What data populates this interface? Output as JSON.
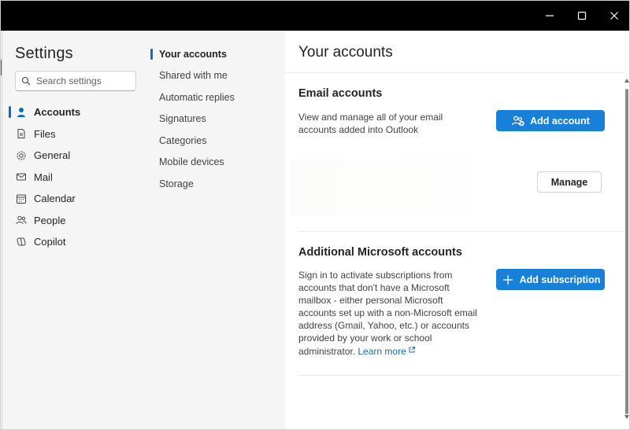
{
  "window": {
    "controls": {
      "minimize_icon": "minimize-icon",
      "maximize_icon": "maximize-icon",
      "close_icon": "close-icon"
    }
  },
  "colors": {
    "accent": "#0f6cbd",
    "primary_button": "#1880d8",
    "sidebar_bg": "#f5f5f5",
    "titlebar_bg": "#000000"
  },
  "sidebar": {
    "title": "Settings",
    "search": {
      "placeholder": "Search settings",
      "value": ""
    },
    "items": [
      {
        "label": "Accounts",
        "icon": "person-icon",
        "active": true
      },
      {
        "label": "Files",
        "icon": "document-icon",
        "active": false
      },
      {
        "label": "General",
        "icon": "gear-icon",
        "active": false
      },
      {
        "label": "Mail",
        "icon": "mail-icon",
        "active": false
      },
      {
        "label": "Calendar",
        "icon": "calendar-icon",
        "active": false
      },
      {
        "label": "People",
        "icon": "people-icon",
        "active": false
      },
      {
        "label": "Copilot",
        "icon": "copilot-icon",
        "active": false
      }
    ]
  },
  "subnav": {
    "items": [
      {
        "label": "Your accounts",
        "active": true
      },
      {
        "label": "Shared with me",
        "active": false
      },
      {
        "label": "Automatic replies",
        "active": false
      },
      {
        "label": "Signatures",
        "active": false
      },
      {
        "label": "Categories",
        "active": false
      },
      {
        "label": "Mobile devices",
        "active": false
      },
      {
        "label": "Storage",
        "active": false
      }
    ]
  },
  "main": {
    "title": "Your accounts",
    "email_accounts": {
      "title": "Email accounts",
      "description": "View and manage all of your email accounts added into Outlook",
      "add_button": "Add account",
      "manage_button": "Manage"
    },
    "additional_accounts": {
      "title": "Additional Microsoft accounts",
      "description": "Sign in to activate subscriptions from accounts that don't have a Microsoft mailbox - either personal Microsoft accounts set up with a non-Microsoft email address (Gmail, Yahoo, etc.) or accounts provided by your work or school administrator.",
      "learn_more": "Learn more",
      "add_button": "Add subscription"
    }
  }
}
